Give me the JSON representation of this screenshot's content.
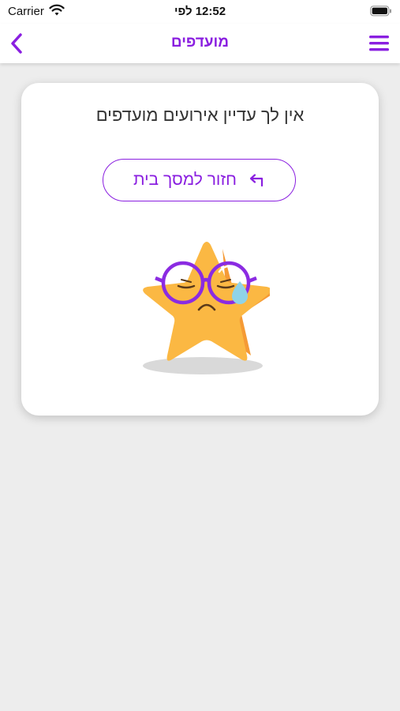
{
  "status_bar": {
    "carrier": "Carrier",
    "time": "12:52 לפי",
    "wifi_icon": "wifi-icon",
    "battery_icon": "battery-icon"
  },
  "nav": {
    "title": "מועדפים",
    "back_icon": "chevron-left-icon",
    "menu_icon": "hamburger-menu-icon"
  },
  "empty_state": {
    "message": "אין לך עדיין אירועים מועדפים",
    "home_button_label": "חזור למסך בית",
    "home_button_icon": "return-arrow-icon",
    "illustration": "sad-star-illustration"
  },
  "colors": {
    "accent": "#8a1fe0",
    "background": "#ededed",
    "card": "#ffffff",
    "star": "#fbb843",
    "star_shade": "#f59a35",
    "tear": "#8fd3e8"
  }
}
